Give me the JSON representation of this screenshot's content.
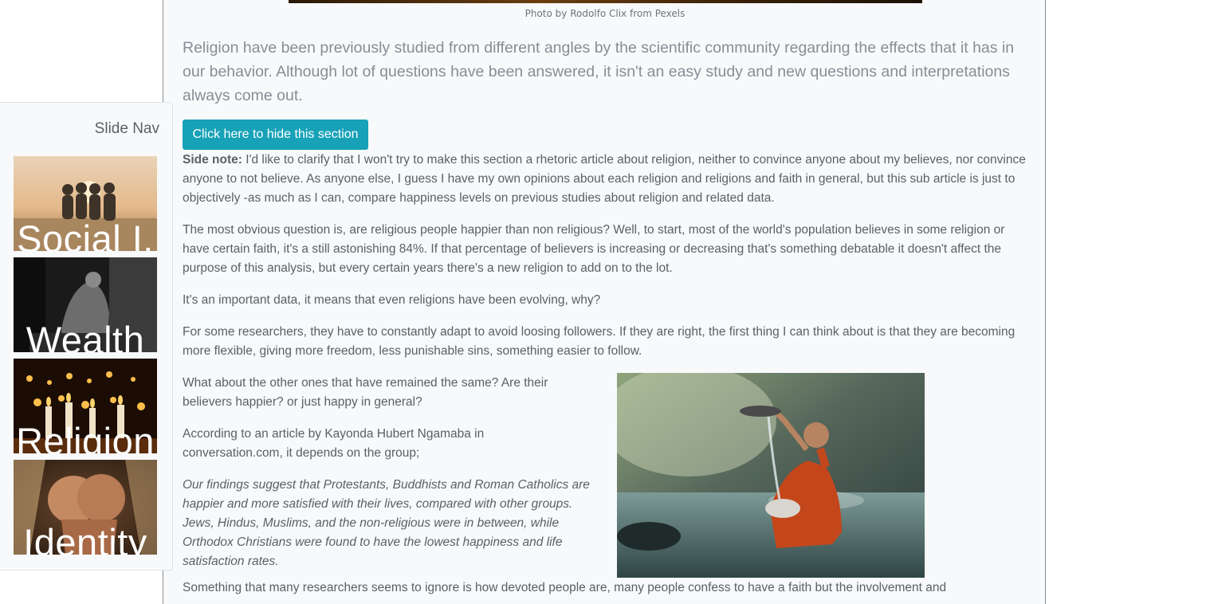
{
  "photo_caption": "Photo by Rodolfo Clix from Pexels",
  "lead_paragraph": "Religion have been previously studied from different angles by the scientific community regarding the effects that it has in our behavior. Although lot of questions have been answered, it isn't an easy study and new questions and interpretations always come out.",
  "hide_button_label": "Click here to hide this section",
  "side_note": {
    "label": "Side note:",
    "text": " I'd like to clarify that I won't try to make this section a rhetoric article about religion, neither to convince anyone about my believes, nor convince anyone to not believe. As anyone else, I guess I have my own opinions about each religion and religions and faith in general, but this sub article is just to objectively -as much as I can, compare happiness levels on previous studies about religion and related data."
  },
  "paragraphs": [
    "The most obvious question is, are religious people happier than non religious? Well, to start, most of the world's population believes in some religion or have certain faith, it's a still astonishing 84%. If that percentage of believers is increasing or decreasing that's something debatable it doesn't affect the purpose of this analysis, but every certain years there's a new religion to add on to the lot.",
    "It's an important data, it means that even religions have been evolving, why?",
    "For some researchers, they have to constantly adapt to avoid loosing followers. If they are right, the first thing I can think about is that they are becoming more flexible, giving more freedom, less punishable sins, something easier to follow.",
    "What about the other ones that have remained the same? Are their believers happier? or just happy in general?",
    "According to an article by Kayonda Hubert Ngamaba in conversation.com, it depends on the group;",
    "Something that many researchers seems to ignore is how devoted people are, many people confess to have a faith but the involvement and"
  ],
  "quote": "Our findings suggest that Protestants, Buddhists and Roman Catholics are happier and more satisfied with their lives, compared with other groups. Jews, Hindus, Muslims, and the non-religious were in between, while Orthodox Christians were found to have the lowest happiness and life satisfaction rates.",
  "side_nav": {
    "title": "Slide Nav",
    "items": [
      {
        "label": "Social I."
      },
      {
        "label": "Wealth"
      },
      {
        "label": "Religion"
      },
      {
        "label": "Identity"
      }
    ]
  },
  "colors": {
    "accent_button": "#17a2b8",
    "panel_background": "#f8f9fa",
    "text": "#5b6066",
    "lead_text": "#868e96"
  }
}
